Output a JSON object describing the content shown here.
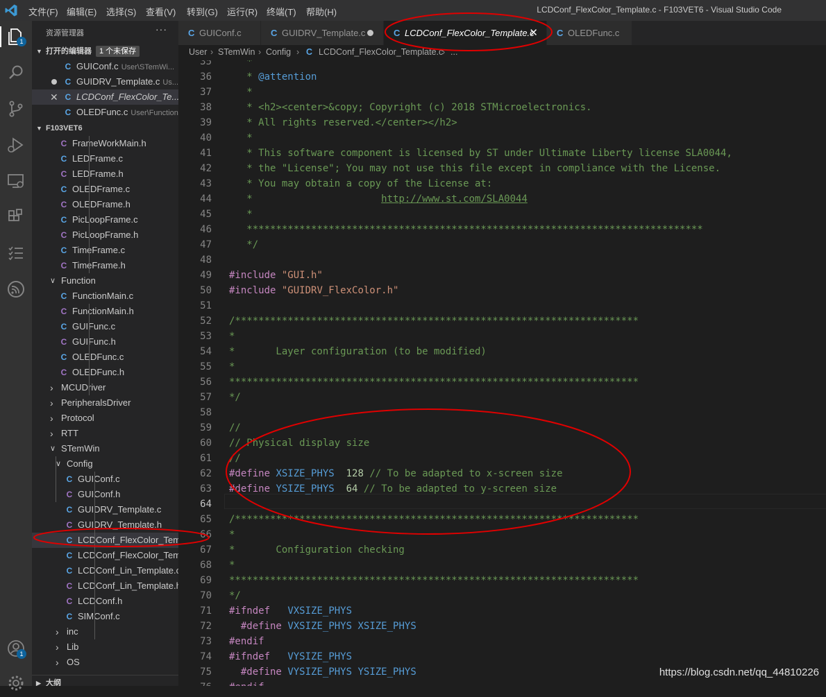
{
  "titlebar": {
    "menus": [
      "文件(F)",
      "编辑(E)",
      "选择(S)",
      "查看(V)",
      "转到(G)",
      "运行(R)",
      "终端(T)",
      "帮助(H)"
    ],
    "window_title": "LCDConf_FlexColor_Template.c - F103VET6 - Visual Studio Code"
  },
  "activity_bar": {
    "icons": [
      "explorer-icon",
      "search-icon",
      "source-control-icon",
      "run-debug-icon",
      "remote-explorer-icon",
      "extensions-icon",
      "testing-icon",
      "espressif-icon",
      "account-icon",
      "settings-gear-icon"
    ],
    "explorer_badge": "1",
    "account_badge": "1"
  },
  "sidebar": {
    "title": "资源管理器",
    "more": "···",
    "open_editors": {
      "header": "打开的编辑器",
      "badge": "1 个未保存",
      "items": [
        {
          "type": "C",
          "name": "GUIConf.c",
          "path": "User\\STemWi..."
        },
        {
          "type": "C",
          "name": "GUIDRV_Template.c",
          "path": "Us..."
        },
        {
          "type": "C",
          "name": "LCDConf_FlexColor_Te...",
          "path": ""
        },
        {
          "type": "C",
          "name": "OLEDFunc.c",
          "path": "User\\Function"
        }
      ]
    },
    "project": {
      "header": "F103VET6",
      "items": [
        {
          "kind": "file",
          "type": "C",
          "name": "FrameWorkMain.h"
        },
        {
          "kind": "file",
          "type": "C",
          "name": "LEDFrame.c"
        },
        {
          "kind": "file",
          "type": "C",
          "name": "LEDFrame.h"
        },
        {
          "kind": "file",
          "type": "C",
          "name": "OLEDFrame.c"
        },
        {
          "kind": "file",
          "type": "C",
          "name": "OLEDFrame.h"
        },
        {
          "kind": "file",
          "type": "C",
          "name": "PicLoopFrame.c"
        },
        {
          "kind": "file",
          "type": "C",
          "name": "PicLoopFrame.h"
        },
        {
          "kind": "file",
          "type": "C",
          "name": "TimeFrame.c"
        },
        {
          "kind": "file",
          "type": "C",
          "name": "TimeFrame.h"
        },
        {
          "kind": "folder",
          "name": "Function",
          "expanded": true
        },
        {
          "kind": "file",
          "type": "C",
          "name": "FunctionMain.c"
        },
        {
          "kind": "file",
          "type": "C",
          "name": "FunctionMain.h"
        },
        {
          "kind": "file",
          "type": "C",
          "name": "GUIFunc.c"
        },
        {
          "kind": "file",
          "type": "C",
          "name": "GUIFunc.h"
        },
        {
          "kind": "file",
          "type": "C",
          "name": "OLEDFunc.c"
        },
        {
          "kind": "file",
          "type": "C",
          "name": "OLEDFunc.h"
        },
        {
          "kind": "folder",
          "name": "MCUDriver",
          "expanded": false
        },
        {
          "kind": "folder",
          "name": "PeripheralsDriver",
          "expanded": false
        },
        {
          "kind": "folder",
          "name": "Protocol",
          "expanded": false
        },
        {
          "kind": "folder",
          "name": "RTT",
          "expanded": false
        },
        {
          "kind": "folder",
          "name": "STemWin",
          "expanded": true
        },
        {
          "kind": "folder",
          "name": "Config",
          "expanded": true
        },
        {
          "kind": "file",
          "type": "C",
          "name": "GUIConf.c"
        },
        {
          "kind": "file",
          "type": "C",
          "name": "GUIConf.h"
        },
        {
          "kind": "file",
          "type": "C",
          "name": "GUIDRV_Template.c"
        },
        {
          "kind": "file",
          "type": "C",
          "name": "GUIDRV_Template.h"
        },
        {
          "kind": "file",
          "type": "C",
          "name": "LCDConf_FlexColor_Tem..."
        },
        {
          "kind": "file",
          "type": "C",
          "name": "LCDConf_FlexColor_Tem..."
        },
        {
          "kind": "file",
          "type": "C",
          "name": "LCDConf_Lin_Template.c"
        },
        {
          "kind": "file",
          "type": "C",
          "name": "LCDConf_Lin_Template.h"
        },
        {
          "kind": "file",
          "type": "C",
          "name": "LCDConf.h"
        },
        {
          "kind": "file",
          "type": "C",
          "name": "SIMConf.c"
        },
        {
          "kind": "folder",
          "name": "inc",
          "expanded": false
        },
        {
          "kind": "folder",
          "name": "Lib",
          "expanded": false
        },
        {
          "kind": "folder",
          "name": "OS",
          "expanded": false
        }
      ]
    },
    "outline_header": "大纲"
  },
  "tabs": [
    {
      "type": "C",
      "label": "GUIConf.c"
    },
    {
      "type": "C",
      "label": "GUIDRV_Template.c"
    },
    {
      "type": "C",
      "label": "LCDConf_FlexColor_Template.c"
    },
    {
      "type": "C",
      "label": "OLEDFunc.c"
    }
  ],
  "breadcrumb": [
    "User",
    "STemWin",
    "Config",
    "C",
    "LCDConf_FlexColor_Template.c",
    "..."
  ],
  "editor": {
    "current_line": "64",
    "lines": [
      {
        "n": "35",
        "t": "   *"
      },
      {
        "n": "36",
        "t": "   * @attention"
      },
      {
        "n": "37",
        "t": "   *"
      },
      {
        "n": "38",
        "t": "   * <h2><center>&copy; Copyright (c) 2018 STMicroelectronics."
      },
      {
        "n": "39",
        "t": "   * All rights reserved.</center></h2>"
      },
      {
        "n": "40",
        "t": "   *"
      },
      {
        "n": "41",
        "t": "   * This software component is licensed by ST under Ultimate Liberty license SLA0044,"
      },
      {
        "n": "42",
        "t": "   * the \"License\"; You may not use this file except in compliance with the License."
      },
      {
        "n": "43",
        "t": "   * You may obtain a copy of the License at:"
      },
      {
        "n": "44",
        "t": "   *                      http://www.st.com/SLA0044"
      },
      {
        "n": "45",
        "t": "   *"
      },
      {
        "n": "46",
        "t": "   ******************************************************************************"
      },
      {
        "n": "47",
        "t": "   */"
      },
      {
        "n": "48",
        "t": ""
      },
      {
        "n": "49",
        "t": "#include \"GUI.h\""
      },
      {
        "n": "50",
        "t": "#include \"GUIDRV_FlexColor.h\""
      },
      {
        "n": "51",
        "t": ""
      },
      {
        "n": "52",
        "t": "/*********************************************************************"
      },
      {
        "n": "53",
        "t": "*"
      },
      {
        "n": "54",
        "t": "*       Layer configuration (to be modified)"
      },
      {
        "n": "55",
        "t": "*"
      },
      {
        "n": "56",
        "t": "**********************************************************************"
      },
      {
        "n": "57",
        "t": "*/"
      },
      {
        "n": "58",
        "t": ""
      },
      {
        "n": "59",
        "t": "//"
      },
      {
        "n": "60",
        "t": "// Physical display size"
      },
      {
        "n": "61",
        "t": "//"
      },
      {
        "n": "62",
        "t": "#define XSIZE_PHYS  128 // To be adapted to x-screen size"
      },
      {
        "n": "63",
        "t": "#define YSIZE_PHYS  64 // To be adapted to y-screen size"
      },
      {
        "n": "64",
        "t": ""
      },
      {
        "n": "65",
        "t": "/*********************************************************************"
      },
      {
        "n": "66",
        "t": "*"
      },
      {
        "n": "67",
        "t": "*       Configuration checking"
      },
      {
        "n": "68",
        "t": "*"
      },
      {
        "n": "69",
        "t": "**********************************************************************"
      },
      {
        "n": "70",
        "t": "*/"
      },
      {
        "n": "71",
        "t": "#ifndef   VXSIZE_PHYS"
      },
      {
        "n": "72",
        "t": "  #define VXSIZE_PHYS XSIZE_PHYS"
      },
      {
        "n": "73",
        "t": "#endif"
      },
      {
        "n": "74",
        "t": "#ifndef   VYSIZE_PHYS"
      },
      {
        "n": "75",
        "t": "  #define VYSIZE_PHYS YSIZE_PHYS"
      },
      {
        "n": "76",
        "t": "#endif"
      }
    ]
  },
  "watermark": "https://blog.csdn.net/qq_44810226",
  "colors": {
    "annotation": "#e00000",
    "accent": "#0e639c"
  }
}
